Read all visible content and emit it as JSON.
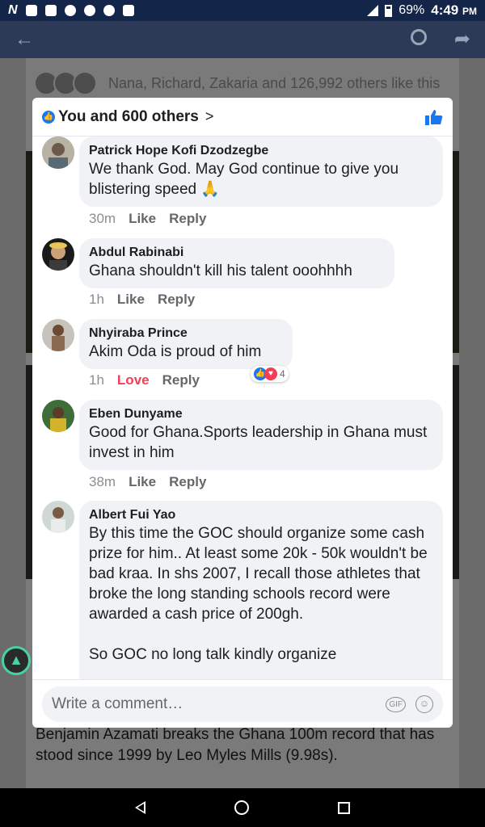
{
  "status_bar": {
    "battery": "69%",
    "time": "4:49",
    "ampm": "PM",
    "n_icon": "N"
  },
  "background_post": {
    "likes_summary": "Nana, Richard, Zakaria and 126,992 others like this",
    "caption": "Benjamin Azamati breaks the Ghana 100m record that has stood since 1999 by Leo Myles Mills (9.98s)."
  },
  "modal": {
    "title": "You and 600 others",
    "chevron": ">",
    "comments": [
      {
        "author": "Patrick Hope Kofi Dzodzegbe",
        "text": "We thank God. May God continue to give you blistering speed 🙏",
        "time": "30m",
        "like": "Like",
        "reply": "Reply"
      },
      {
        "author": "Abdul Rabinabi",
        "text": "Ghana shouldn't kill his talent ooohhhh",
        "time": "1h",
        "like": "Like",
        "reply": "Reply"
      },
      {
        "author": "Nhyiraba Prince",
        "text": "Akim Oda is proud of him",
        "time": "1h",
        "like": "Love",
        "reply": "Reply",
        "reaction_count": "4"
      },
      {
        "author": "Eben Dunyame",
        "text": "Good for Ghana.Sports leadership in Ghana must invest in him",
        "time": "38m",
        "like": "Like",
        "reply": "Reply"
      },
      {
        "author": "Albert Fui Yao",
        "text": "By this time the GOC should organize some cash prize for him.. At least some 20k - 50k wouldn't be bad kraa. In shs 2007, I recall those athletes that broke the long standing schools record were awarded a cash price of 200gh.\n\nSo GOC no long talk kindly organize",
        "time": "",
        "like": "",
        "reply": ""
      }
    ],
    "composer": {
      "placeholder": "Write a comment…",
      "gif": "GIF"
    }
  },
  "colors": {
    "accent": "#1877f2",
    "love": "#f33e58",
    "header": "#2c3a57"
  },
  "icons": {
    "back": "arrow-left-icon",
    "search": "search-icon",
    "share": "share-icon",
    "like": "thumbs-up-icon"
  }
}
